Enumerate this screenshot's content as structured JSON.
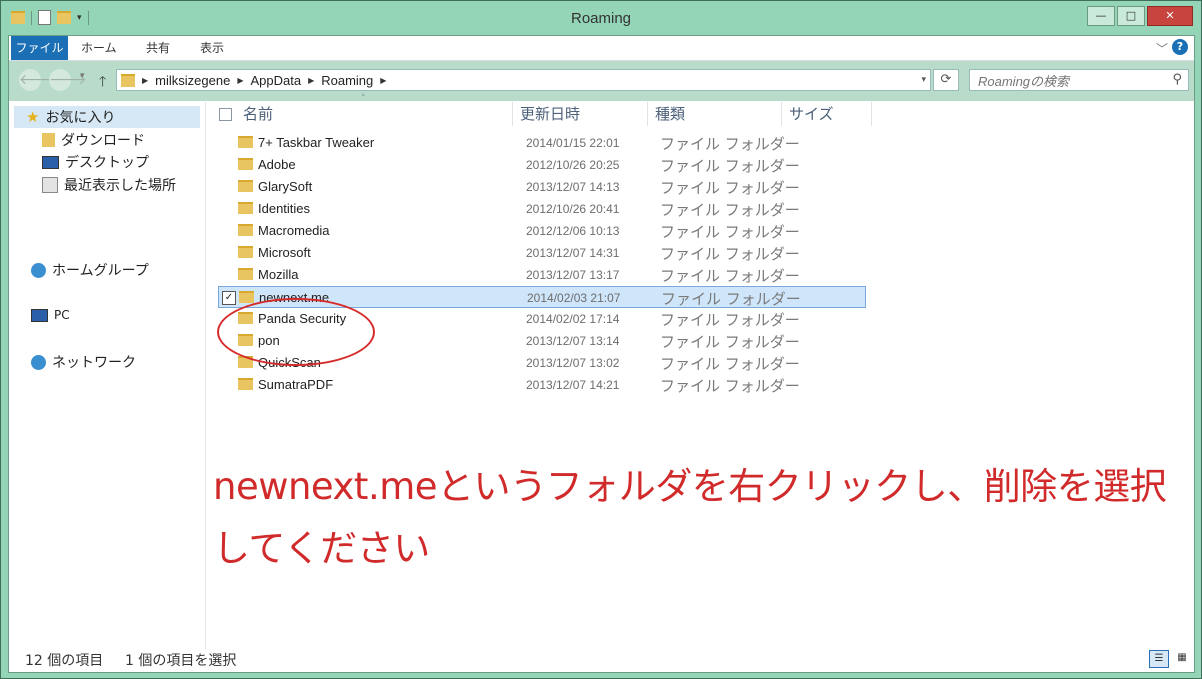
{
  "window": {
    "title": "Roaming",
    "controls": {
      "minimize": "—",
      "maximize": "□",
      "close": "✕"
    }
  },
  "ribbon": {
    "tabs": [
      {
        "label": "ファイル"
      },
      {
        "label": "ホーム"
      },
      {
        "label": "共有"
      },
      {
        "label": "表示"
      }
    ]
  },
  "address": {
    "crumbs": [
      "milksizegene",
      "AppData",
      "Roaming"
    ],
    "search_placeholder": "Roamingの検索"
  },
  "navpane": {
    "favorites": "お気に入り",
    "fav_items": [
      "ダウンロード",
      "デスクトップ",
      "最近表示した場所"
    ],
    "homegroup": "ホームグループ",
    "pc": "PC",
    "network": "ネットワーク"
  },
  "columns": [
    "名前",
    "更新日時",
    "種類",
    "サイズ"
  ],
  "files": [
    {
      "name": "7+ Taskbar Tweaker",
      "date": "2014/01/15 22:01",
      "type": "ファイル フォルダー"
    },
    {
      "name": "Adobe",
      "date": "2012/10/26 20:25",
      "type": "ファイル フォルダー"
    },
    {
      "name": "GlarySoft",
      "date": "2013/12/07 14:13",
      "type": "ファイル フォルダー"
    },
    {
      "name": "Identities",
      "date": "2012/10/26 20:41",
      "type": "ファイル フォルダー"
    },
    {
      "name": "Macromedia",
      "date": "2012/12/06 10:13",
      "type": "ファイル フォルダー"
    },
    {
      "name": "Microsoft",
      "date": "2013/12/07 14:31",
      "type": "ファイル フォルダー"
    },
    {
      "name": "Mozilla",
      "date": "2013/12/07 13:17",
      "type": "ファイル フォルダー"
    },
    {
      "name": "newnext.me",
      "date": "2014/02/03 21:07",
      "type": "ファイル フォルダー"
    },
    {
      "name": "Panda Security",
      "date": "2014/02/02 17:14",
      "type": "ファイル フォルダー"
    },
    {
      "name": "pon",
      "date": "2013/12/07 13:14",
      "type": "ファイル フォルダー"
    },
    {
      "name": "QuickScan",
      "date": "2013/12/07 13:02",
      "type": "ファイル フォルダー"
    },
    {
      "name": "SumatraPDF",
      "date": "2013/12/07 14:21",
      "type": "ファイル フォルダー"
    }
  ],
  "instruction": "newnext.meというフォルダを右クリックし、削除を選択してください",
  "status": {
    "count": "12 個の項目",
    "selected": "1 個の項目を選択"
  },
  "colors": {
    "accent": "#1a6fb5",
    "annotation": "#d12a2a",
    "frame": "#93d5b6"
  }
}
